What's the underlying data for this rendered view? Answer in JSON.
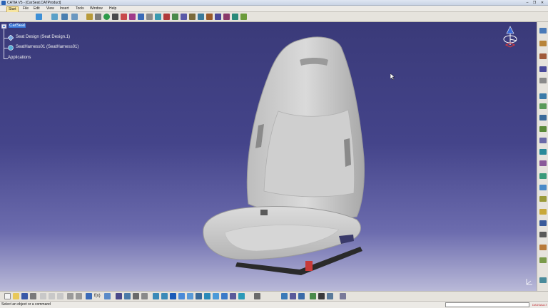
{
  "window": {
    "title": "CATIA V5 - [CarSeat.CATProduct]",
    "minimize_icon": "minimize-icon",
    "restore_icon": "restore-icon",
    "close_icon": "close-icon"
  },
  "menubar": {
    "items": [
      {
        "label": "Start",
        "active": true
      },
      {
        "label": "File"
      },
      {
        "label": "Edit"
      },
      {
        "label": "View"
      },
      {
        "label": "Insert"
      },
      {
        "label": "Tools"
      },
      {
        "label": "Window"
      },
      {
        "label": "Help"
      }
    ]
  },
  "tree": {
    "root": "CarSeat",
    "children": [
      {
        "label": "Seat Design (Seat Design.1)",
        "icon": "part-icon"
      },
      {
        "label": "SeatHarness01 (SeatHarness01)",
        "icon": "harness-icon"
      }
    ],
    "applications": "Applications"
  },
  "bottom_toolbar": {
    "fx_label": "f(x)"
  },
  "statusbar": {
    "message": "Select an object or a command",
    "logo": "DASSAULT"
  },
  "colors": {
    "viewport_top": "#3a3a79",
    "viewport_bottom": "#b9b9d8",
    "tree_selection": "#3a78d8",
    "seat": "#d2d2d2"
  }
}
